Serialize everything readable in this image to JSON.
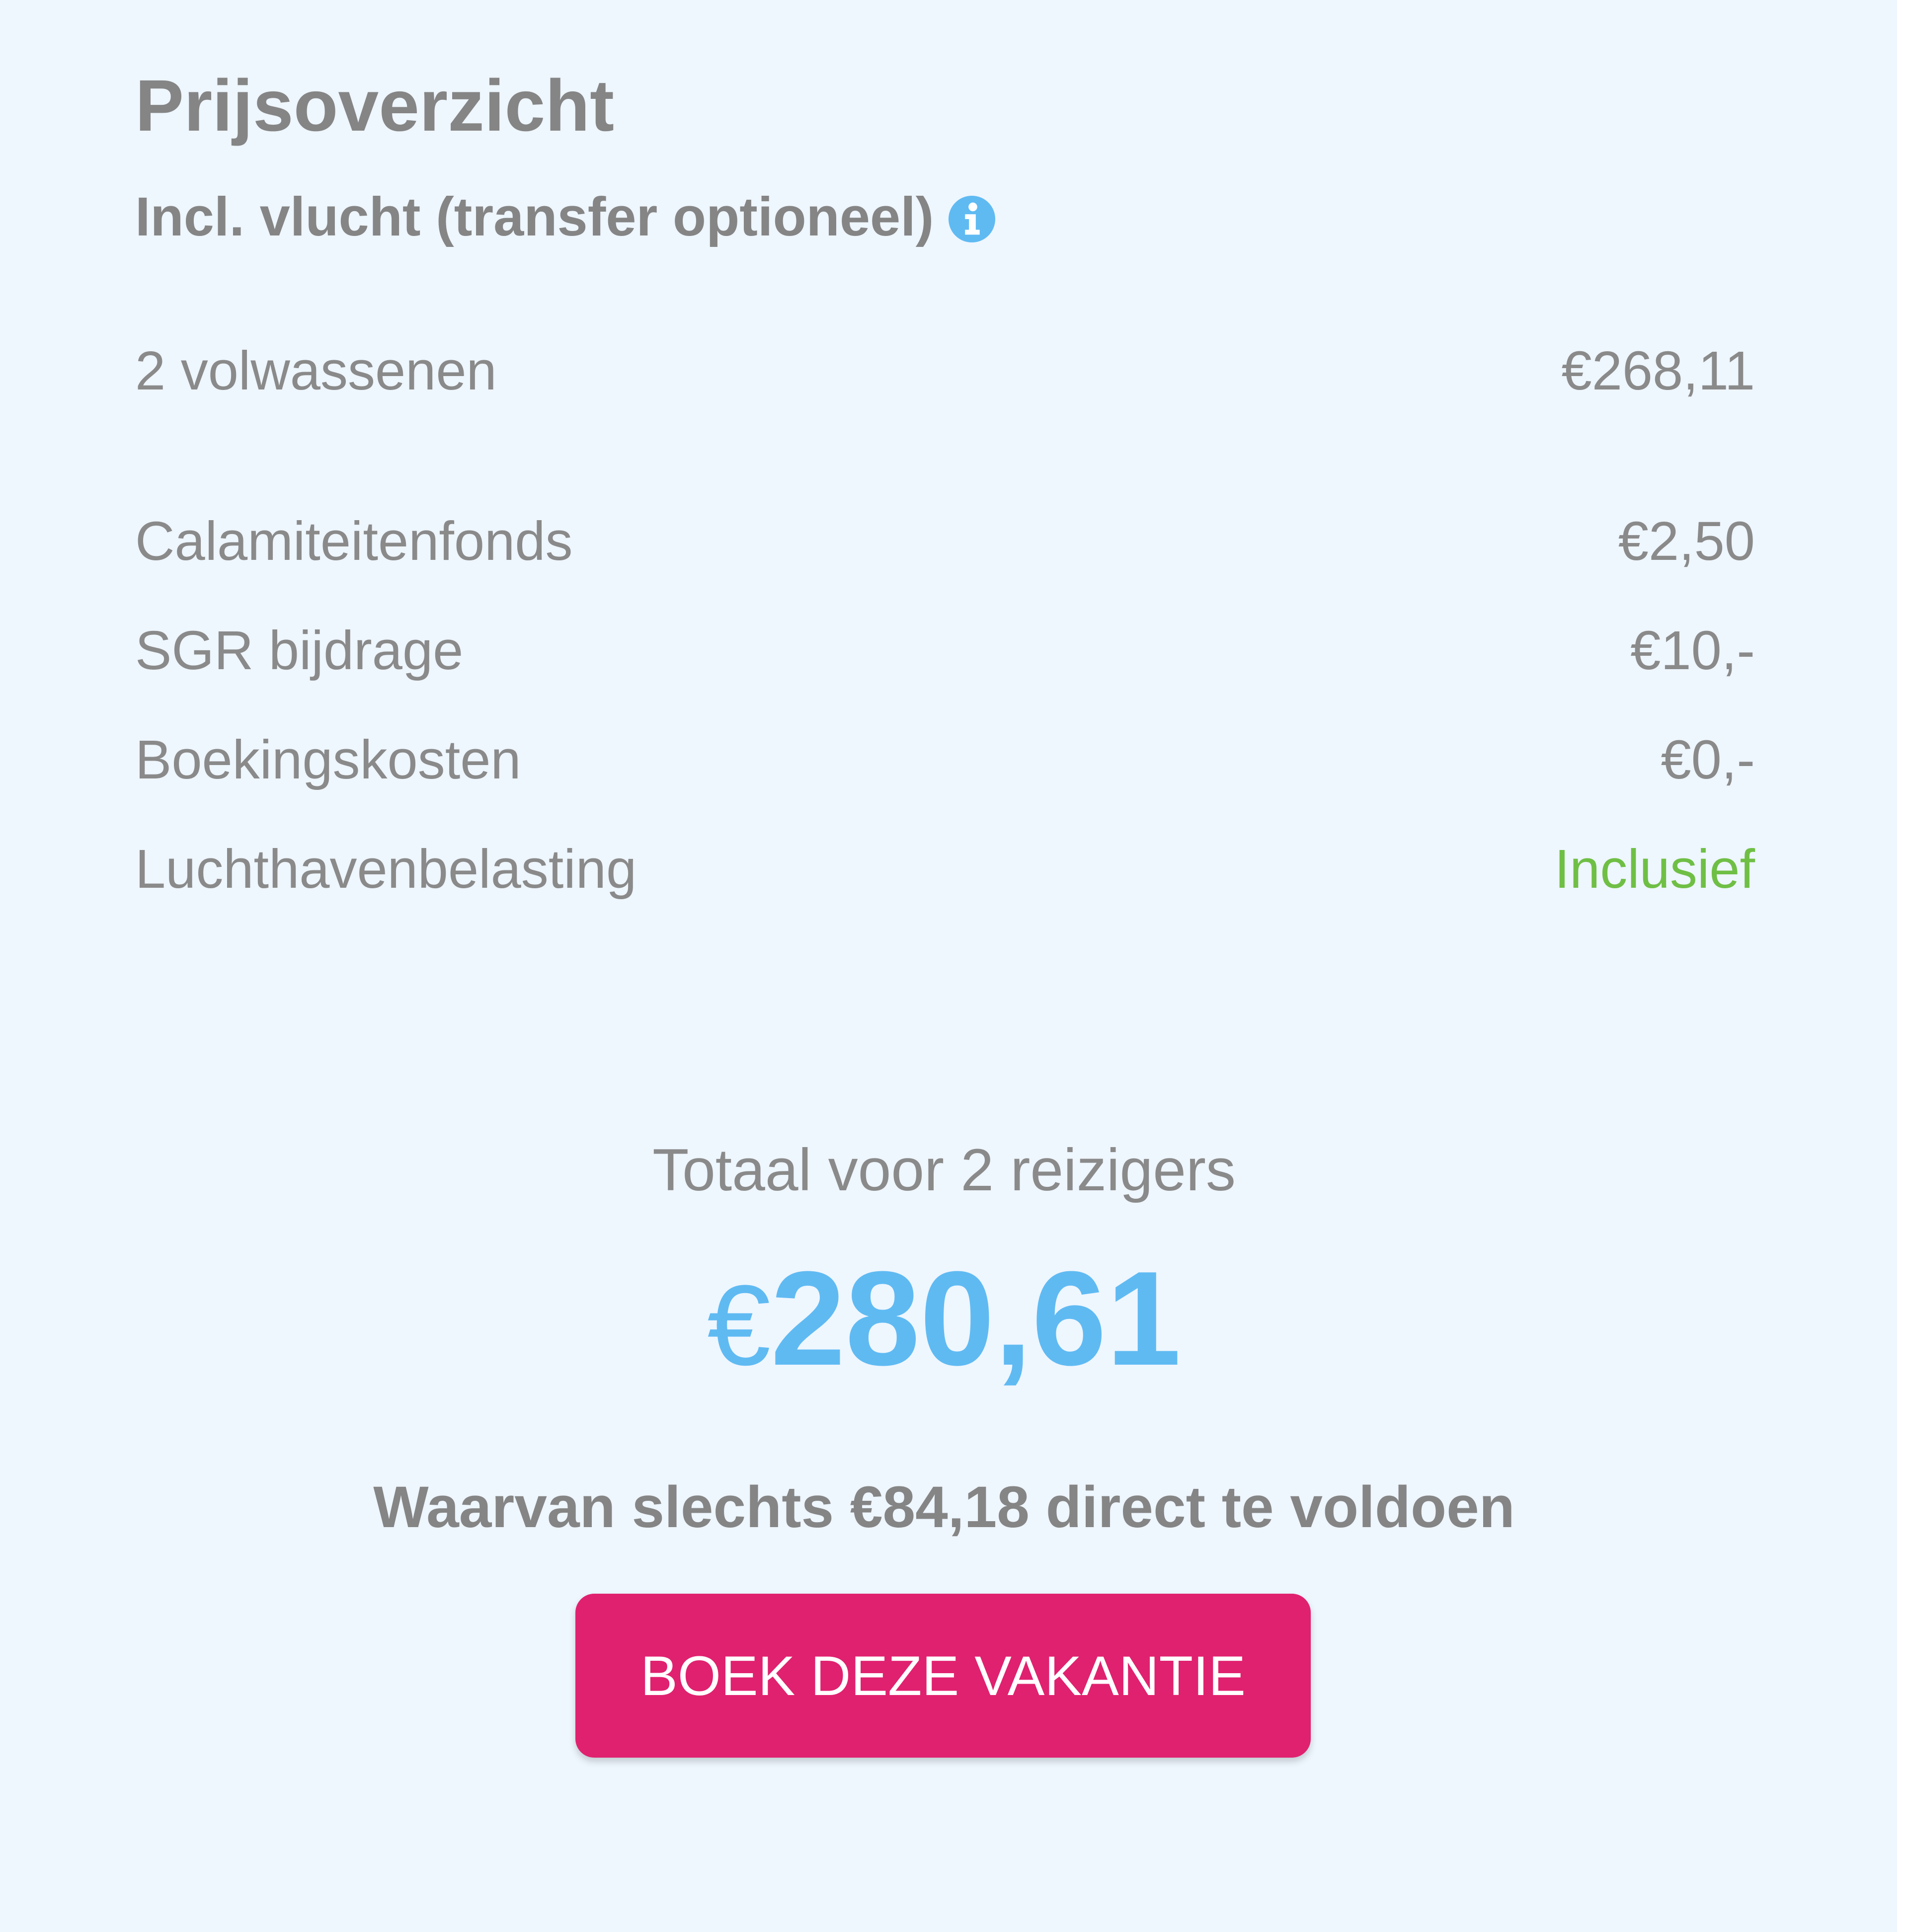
{
  "price_overview": {
    "title": "Prijsoverzicht",
    "subtitle": "Incl. vlucht (transfer optioneel)",
    "info_icon": "info-icon",
    "lines": [
      {
        "label": "2 volwassenen",
        "value": "€268,11"
      },
      {
        "label": "Calamiteitenfonds",
        "value": "€2,50"
      },
      {
        "label": "SGR bijdrage",
        "value": "€10,-"
      },
      {
        "label": "Boekingskosten",
        "value": "€0,-"
      },
      {
        "label": "Luchthavenbelasting",
        "value": "Inclusief"
      }
    ],
    "total_label": "Totaal voor 2 reizigers",
    "total_currency": "€",
    "total_amount": "280,61",
    "pay_now_text": "Waarvan slechts €84,18 direct te voldoen",
    "book_button_label": "BOEK DEZE VAKANTIE"
  },
  "colors": {
    "panel_background": "#eef6fe",
    "text_gray": "#858585",
    "accent_blue": "#5fbaf2",
    "included_green": "#6fbf45",
    "button_pink": "#e0216f"
  }
}
